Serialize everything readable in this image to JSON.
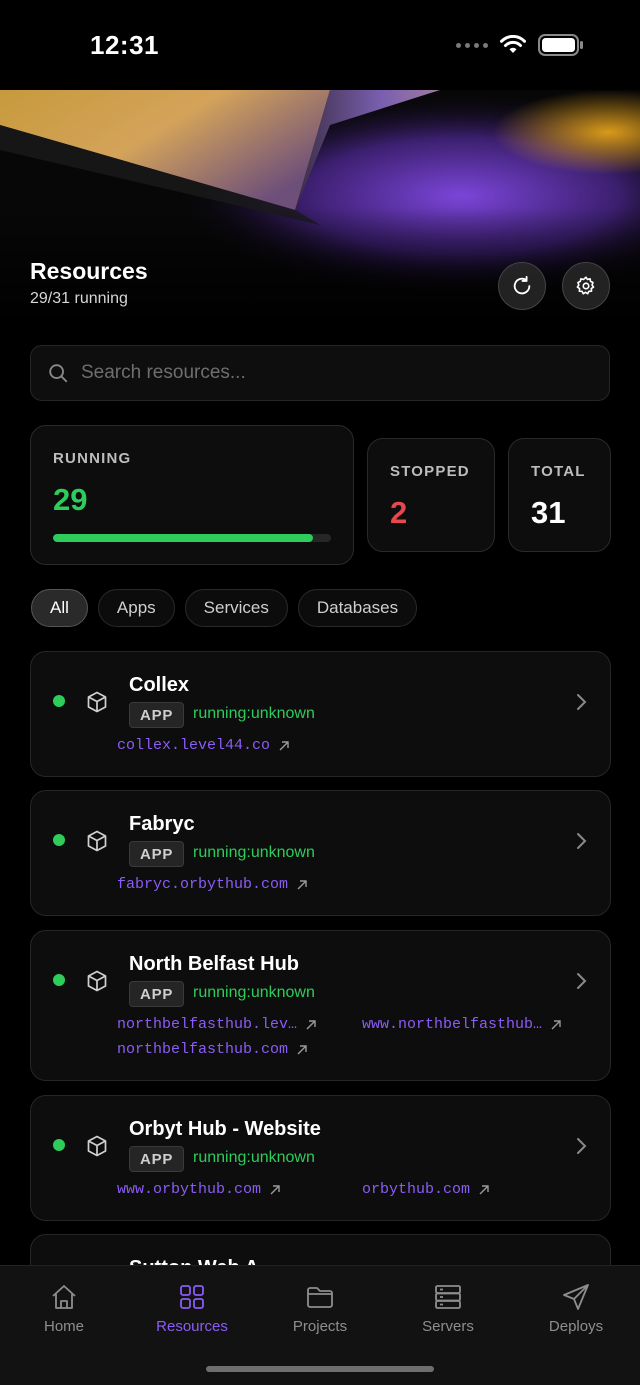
{
  "status_bar": {
    "time": "12:31"
  },
  "header": {
    "title": "Resources",
    "subtitle": "29/31 running"
  },
  "search": {
    "placeholder": "Search resources..."
  },
  "stats": {
    "running": {
      "label": "RUNNING",
      "value": "29",
      "fraction": 0.935,
      "color": "#2ecc5a"
    },
    "stopped": {
      "label": "STOPPED",
      "value": "2",
      "color": "#e5484d"
    },
    "total": {
      "label": "TOTAL",
      "value": "31"
    }
  },
  "filters": [
    {
      "label": "All",
      "active": true
    },
    {
      "label": "Apps",
      "active": false
    },
    {
      "label": "Services",
      "active": false
    },
    {
      "label": "Databases",
      "active": false
    }
  ],
  "resources": [
    {
      "name": "Collex",
      "badge": "APP",
      "status": "running:unknown",
      "links": [
        "collex.level44.co"
      ]
    },
    {
      "name": "Fabryc",
      "badge": "APP",
      "status": "running:unknown",
      "links": [
        "fabryc.orbythub.com"
      ]
    },
    {
      "name": "North Belfast Hub",
      "badge": "APP",
      "status": "running:unknown",
      "links": [
        "northbelfasthub.lev…",
        "www.northbelfasthub…",
        "northbelfasthub.com"
      ]
    },
    {
      "name": "Orbyt Hub - Website",
      "badge": "APP",
      "status": "running:unknown",
      "links": [
        "www.orbythub.com",
        "orbythub.com"
      ]
    },
    {
      "name": "Sutton Web A…"
    }
  ],
  "tabs": [
    {
      "label": "Home",
      "icon": "house-icon"
    },
    {
      "label": "Resources",
      "icon": "grid-icon",
      "active": true
    },
    {
      "label": "Projects",
      "icon": "folder-icon"
    },
    {
      "label": "Servers",
      "icon": "server-icon"
    },
    {
      "label": "Deploys",
      "icon": "paper-plane-icon"
    }
  ],
  "colors": {
    "accent": "#8b5cf6",
    "running": "#2ecc5a",
    "stopped": "#e5484d"
  }
}
